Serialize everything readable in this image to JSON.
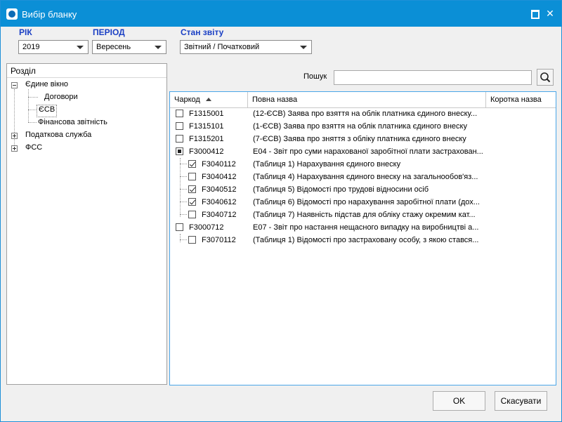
{
  "window": {
    "title": "Вибір бланку",
    "accent": "#0b8fd6"
  },
  "filters": {
    "year": {
      "label": "РІК",
      "value": "2019"
    },
    "period": {
      "label": "ПЕРІОД",
      "value": "Вересень"
    },
    "state": {
      "label": "Стан звіту",
      "value": "Звітний / Початковий"
    }
  },
  "tree": {
    "header": "Розділ",
    "nodes": [
      {
        "label": "Єдине вікно",
        "expanded": true
      },
      {
        "label": "Договори"
      },
      {
        "label": "ЄСВ",
        "selected": true
      },
      {
        "label": "Фінансова звітність"
      },
      {
        "label": "Податкова служба",
        "expanded": false
      },
      {
        "label": "ФСС",
        "expanded": false
      }
    ]
  },
  "search": {
    "label": "Пошук",
    "value": "",
    "icon": "search-icon"
  },
  "grid": {
    "columns": [
      "Чаркод",
      "Повна назва",
      "Коротка назва"
    ],
    "rows": [
      {
        "code": "F1315001",
        "name": "(12-ЄСВ) Заява про взяття на облік платника єдиного внеску...",
        "check": "unchecked",
        "level": 0
      },
      {
        "code": "F1315101",
        "name": "(1-ЄСВ) Заява про взяття на облік платника єдиного внеску",
        "check": "unchecked",
        "level": 0
      },
      {
        "code": "F1315201",
        "name": "(7-ЄСВ) Заява про зняття з обліку платника єдиного внеску",
        "check": "unchecked",
        "level": 0
      },
      {
        "code": "F3000412",
        "name": "Е04 - Звіт про суми нарахованої заробітної плати застрахован...",
        "check": "partial",
        "level": 0
      },
      {
        "code": "F3040112",
        "name": "(Таблиця 1) Нарахування єдиного внеску",
        "check": "checked",
        "level": 1
      },
      {
        "code": "F3040412",
        "name": "(Таблиця 4) Нарахування єдиного внеску на загальнообов'яз...",
        "check": "unchecked",
        "level": 1
      },
      {
        "code": "F3040512",
        "name": "(Таблиця 5) Відомості про трудові відносини осіб",
        "check": "checked",
        "level": 1
      },
      {
        "code": "F3040612",
        "name": "(Таблиця 6) Відомості про нарахування заробітної плати (дох...",
        "check": "checked",
        "level": 1
      },
      {
        "code": "F3040712",
        "name": "(Таблиця 7) Наявність підстав для обліку стажу окремим кат...",
        "check": "unchecked",
        "level": 1
      },
      {
        "code": "F3000712",
        "name": "Е07 - Звіт про настання нещасного випадку на виробництві а...",
        "check": "unchecked",
        "level": 0
      },
      {
        "code": "F3070112",
        "name": "(Таблиця 1) Відомості про застраховану особу, з якою стався...",
        "check": "unchecked",
        "level": 1
      }
    ]
  },
  "buttons": {
    "ok": "OK",
    "cancel": "Скасувати"
  }
}
